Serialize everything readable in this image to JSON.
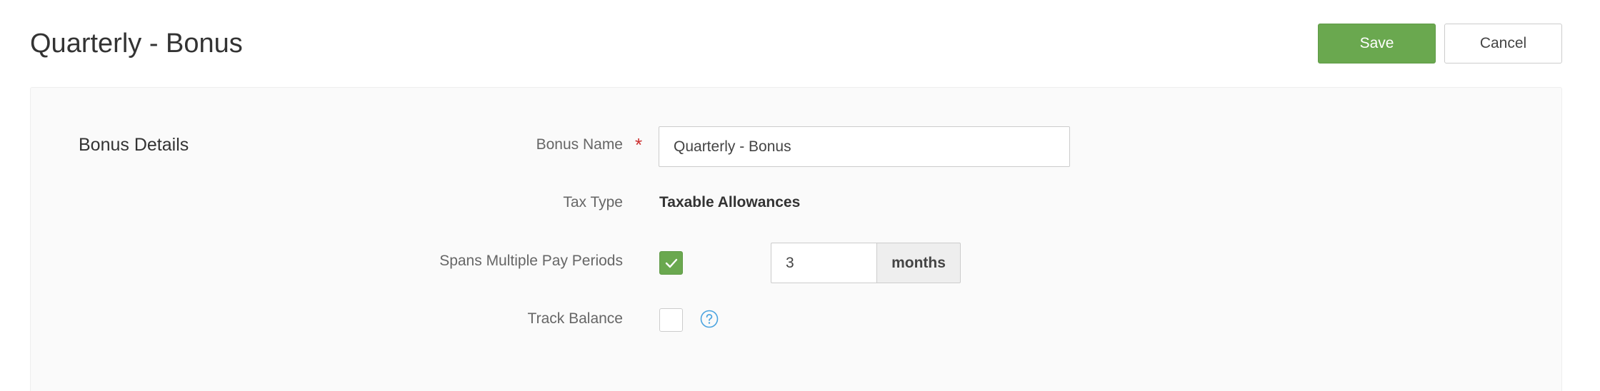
{
  "header": {
    "title": "Quarterly - Bonus",
    "save_label": "Save",
    "cancel_label": "Cancel"
  },
  "section": {
    "title": "Bonus Details"
  },
  "fields": {
    "bonus_name": {
      "label": "Bonus Name",
      "required_marker": "*",
      "value": "Quarterly - Bonus"
    },
    "tax_type": {
      "label": "Tax Type",
      "value": "Taxable Allowances"
    },
    "spans_multiple_pay_periods": {
      "label": "Spans Multiple Pay Periods",
      "checked": true,
      "months_value": "3",
      "months_unit": "months"
    },
    "track_balance": {
      "label": "Track Balance",
      "checked": false
    }
  },
  "icons": {
    "check": "check-icon",
    "help": "question-circle-icon"
  },
  "colors": {
    "accent_green": "#6aa84f",
    "required_red": "#cc2f2f",
    "help_blue": "#4aa3df"
  }
}
